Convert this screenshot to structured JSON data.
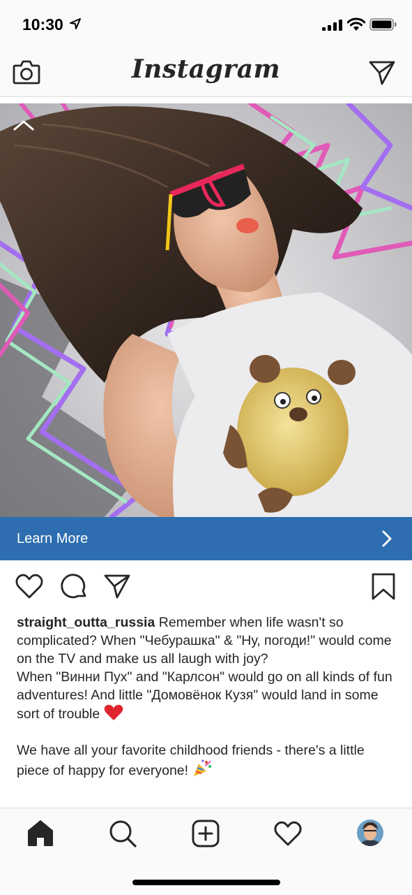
{
  "status_bar": {
    "time": "10:30"
  },
  "top_nav": {
    "logo": "Instagram"
  },
  "post": {
    "cta_label": "Learn More",
    "username": "straight_outta_russia",
    "caption_lines": [
      "Remember when life wasn't so complicated? When \"Чебурашка\" & \"Ну, погоди!\" would come on the TV and make us all laugh with joy?",
      "When \"Винни Пух\" and \"Карлсон\" would go on all kinds of fun adventures! And little \"Домовёнок Кузя\" would land in some sort of trouble",
      "We have all your favorite childhood friends - there's a little piece of happy for everyone!"
    ]
  },
  "colors": {
    "cta_bg": "#2e6eb0",
    "text": "#262626",
    "bar_bg": "#fafafa"
  },
  "icons": {
    "status": [
      "location-arrow-icon",
      "signal-icon",
      "wifi-icon",
      "battery-icon"
    ],
    "nav": [
      "camera-icon",
      "direct-message-icon"
    ],
    "actions": [
      "heart-icon",
      "comment-icon",
      "share-icon",
      "bookmark-icon"
    ],
    "tabs": [
      "home-icon",
      "search-icon",
      "new-post-icon",
      "activity-heart-icon",
      "profile-avatar"
    ]
  }
}
